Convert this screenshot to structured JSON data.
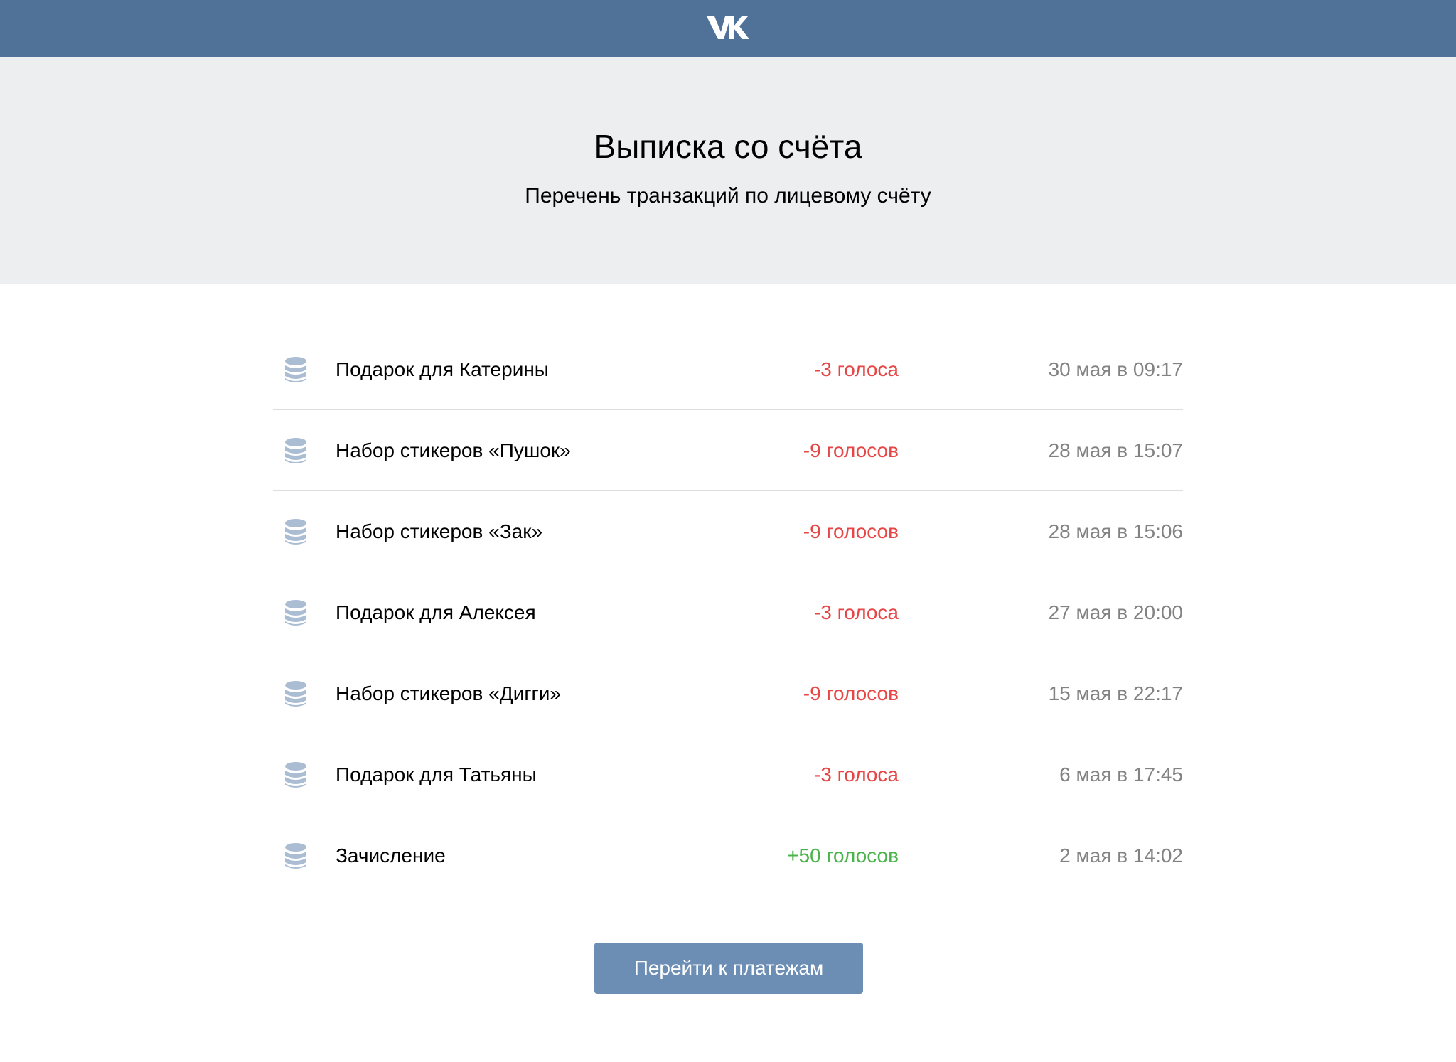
{
  "header": {
    "logo_icon": "vk-logo-icon",
    "bar_color": "#507299"
  },
  "hero": {
    "title": "Выписка со счёта",
    "subtitle": "Перечень транзакций по лицевому счёту"
  },
  "colors": {
    "negative": "#e64646",
    "positive": "#4bb34b",
    "date": "#828282",
    "coin": "#aabdd3",
    "button": "#6c8eb4"
  },
  "transactions": [
    {
      "icon": "coins-icon",
      "name": "Подарок для Катерины",
      "amount": "-3 голоса",
      "type": "neg",
      "date": "30 мая в 09:17"
    },
    {
      "icon": "coins-icon",
      "name": "Набор стикеров «Пушок»",
      "amount": "-9 голосов",
      "type": "neg",
      "date": "28 мая в 15:07"
    },
    {
      "icon": "coins-icon",
      "name": "Набор стикеров «Зак»",
      "amount": "-9 голосов",
      "type": "neg",
      "date": "28 мая в 15:06"
    },
    {
      "icon": "coins-icon",
      "name": "Подарок для Алексея",
      "amount": "-3 голоса",
      "type": "neg",
      "date": "27 мая в 20:00"
    },
    {
      "icon": "coins-icon",
      "name": "Набор стикеров «Дигги»",
      "amount": "-9 голосов",
      "type": "neg",
      "date": "15 мая в 22:17"
    },
    {
      "icon": "coins-icon",
      "name": "Подарок для Татьяны",
      "amount": "-3 голоса",
      "type": "neg",
      "date": "6 мая в 17:45"
    },
    {
      "icon": "coins-icon",
      "name": "Зачисление",
      "amount": "+50 голосов",
      "type": "pos",
      "date": "2 мая в 14:02"
    }
  ],
  "actions": {
    "payments_button": "Перейти к платежам"
  }
}
